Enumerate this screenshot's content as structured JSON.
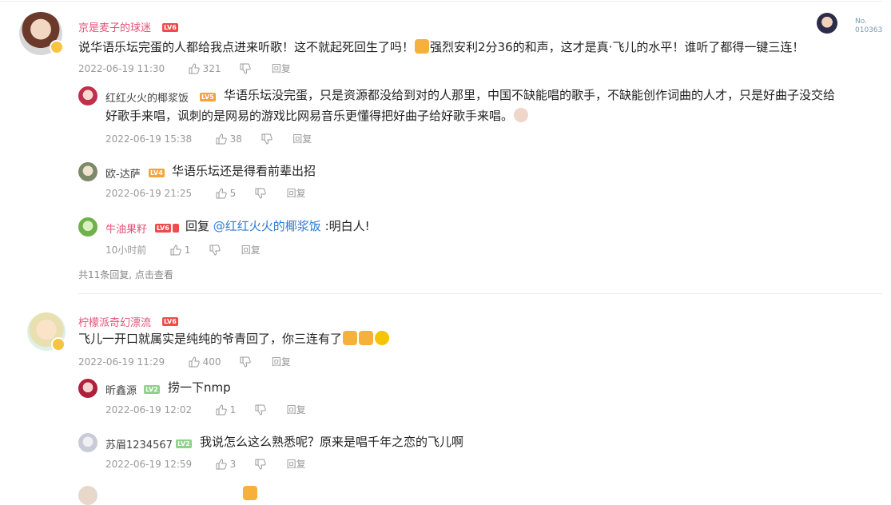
{
  "header": {
    "no_label": "No.",
    "no_value": "010363"
  },
  "comments": [
    {
      "user": "京是麦子的球迷",
      "level": "LV6",
      "text": "说华语乐坛完蛋的人都给我点进来听歌！这不就起死回生了吗！",
      "text2": "强烈安利2分36的和声，这才是真·飞儿的水平！谁听了都得一键三连！",
      "time": "2022-06-19 11:30",
      "likes": "321",
      "reply_label": "回复",
      "replies": [
        {
          "user": "红红火火的椰浆饭",
          "level": "LV5",
          "text": "华语乐坛没完蛋，只是资源都没给到对的人那里，中国不缺能唱的歌手，不缺能创作词曲的人才，只是好曲子没交给",
          "text2": "好歌手来唱，讽刺的是网易的游戏比网易音乐更懂得把好曲子给好歌手来唱。",
          "time": "2022-06-19 15:38",
          "likes": "38",
          "reply_label": "回复"
        },
        {
          "user": "欧-达萨",
          "level": "LV4",
          "text": "华语乐坛还是得看前辈出招",
          "time": "2022-06-19 21:25",
          "likes": "5",
          "reply_label": "回复"
        },
        {
          "user": "牛油果籽",
          "level": "LV6",
          "text_prefix": "回复",
          "mention": "@红红火火的椰浆饭",
          "text": ":明白人!",
          "time": "10小时前",
          "likes": "1",
          "reply_label": "回复"
        }
      ],
      "more_replies": "共11条回复, 点击查看"
    },
    {
      "user": "柠檬派奇幻漂流",
      "level": "LV6",
      "text": "飞儿一开口就属实是纯纯的爷青回了，你三连有了",
      "time": "2022-06-19 11:29",
      "likes": "400",
      "reply_label": "回复",
      "replies": [
        {
          "user": "昕鑫源",
          "level": "LV2",
          "text": "捞一下nmp",
          "time": "2022-06-19 12:02",
          "likes": "1",
          "reply_label": "回复"
        },
        {
          "user": "苏眉1234567",
          "level": "LV2",
          "text": "我说怎么这么熟悉呢？原来是唱千年之恋的飞儿啊",
          "time": "2022-06-19 12:59",
          "likes": "3",
          "reply_label": "回复"
        }
      ]
    }
  ]
}
